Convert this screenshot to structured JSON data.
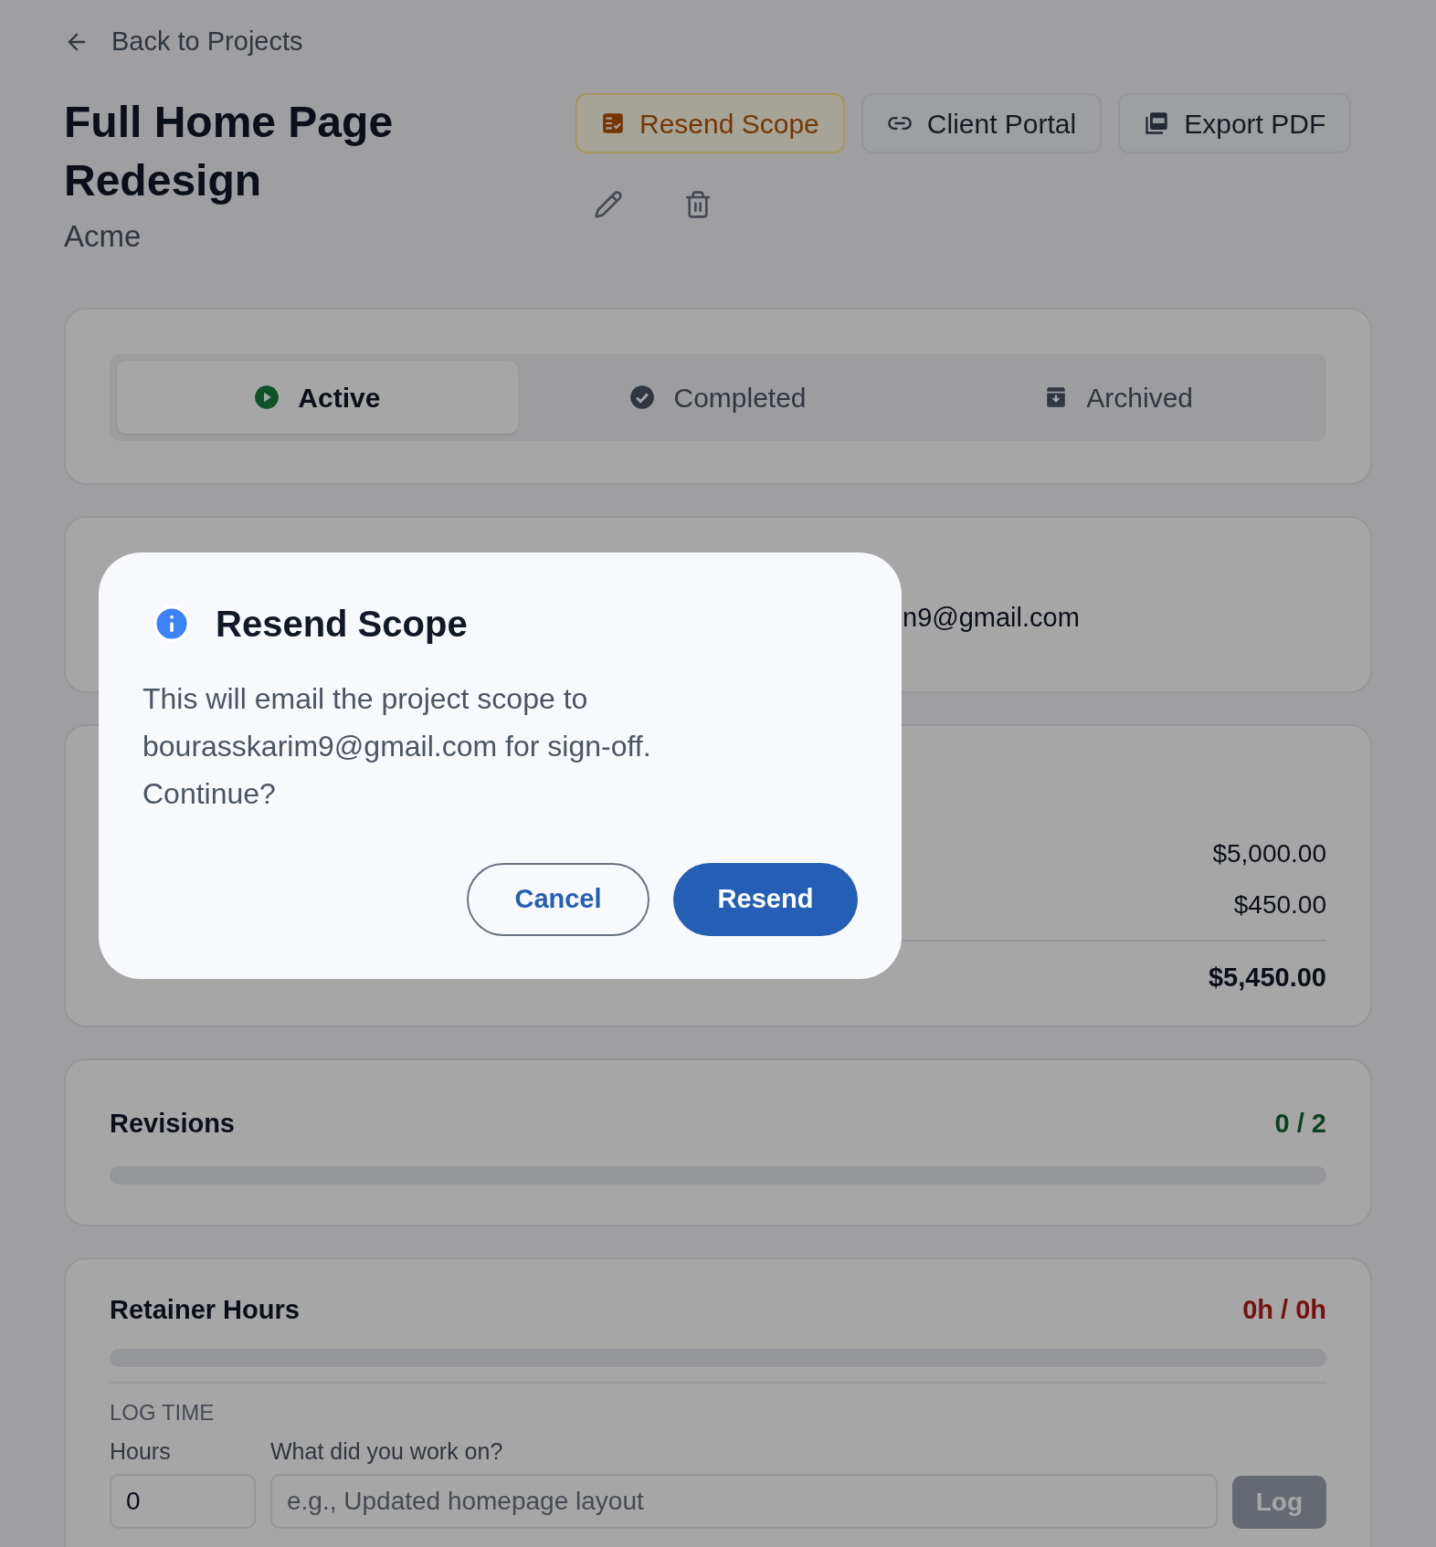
{
  "back_link": {
    "label": "Back to Projects"
  },
  "project": {
    "title": "Full Home Page Redesign",
    "client": "Acme"
  },
  "actions": [
    {
      "label": "Resend Scope",
      "kind": "scope",
      "highlighted": true
    },
    {
      "label": "Client Portal",
      "kind": "link",
      "highlighted": false
    },
    {
      "label": "Export PDF",
      "kind": "pdf",
      "highlighted": false
    }
  ],
  "status_tabs": [
    {
      "label": "Active",
      "kind": "active",
      "selected": true
    },
    {
      "label": "Completed",
      "kind": "completed",
      "selected": false
    },
    {
      "label": "Archived",
      "kind": "archived",
      "selected": false
    }
  ],
  "client_card": {
    "email_fragment": "n9@gmail.com"
  },
  "pricing": {
    "lines": [
      "$5,000.00",
      "$450.00"
    ],
    "total": "$5,450.00"
  },
  "revisions": {
    "title": "Revisions",
    "count": "0 / 2",
    "level": 0
  },
  "retainer": {
    "title": "Retainer Hours",
    "count": "0h / 0h",
    "level": 0,
    "section": "LOG TIME",
    "hours_label": "Hours",
    "hours_value": "0",
    "desc_label": "What did you work on?",
    "desc_placeholder": "e.g., Updated homepage layout",
    "log_button": "Log",
    "log_disabled": true
  },
  "dialog": {
    "title": "Resend Scope",
    "message": "This will email the project scope to bourasskarim9@gmail.com for sign-off. Continue?",
    "buttons": [
      {
        "label": "Cancel",
        "kind": "secondary"
      },
      {
        "label": "Resend",
        "kind": "primary"
      }
    ]
  }
}
